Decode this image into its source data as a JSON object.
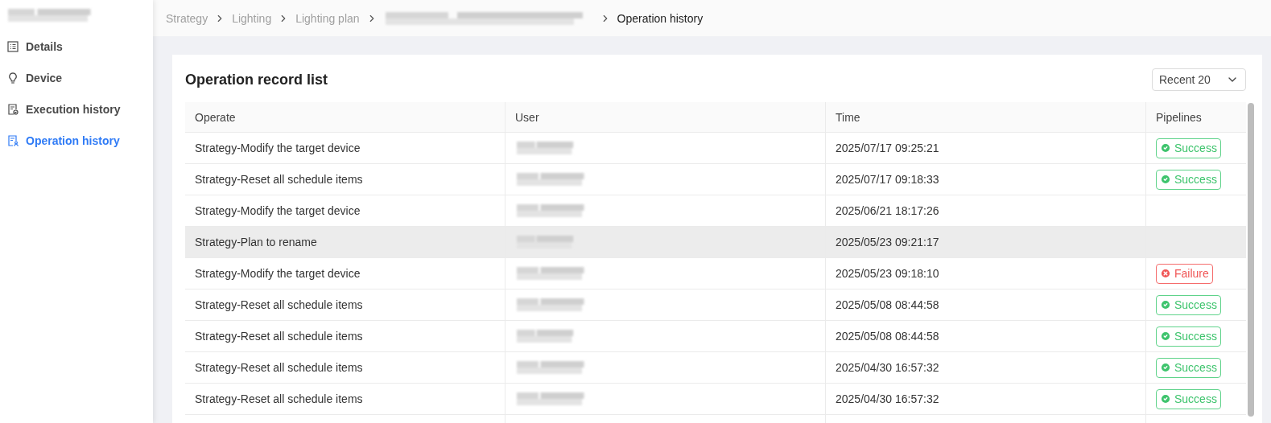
{
  "sidebar": {
    "items": [
      {
        "label": "Details",
        "selected": false
      },
      {
        "label": "Device",
        "selected": false
      },
      {
        "label": "Execution history",
        "selected": false
      },
      {
        "label": "Operation history",
        "selected": true
      }
    ]
  },
  "breadcrumb": [
    "Strategy",
    "Lighting",
    "Lighting plan",
    "Operation history"
  ],
  "card": {
    "title": "Operation record list",
    "filter": {
      "value": "Recent 20"
    }
  },
  "table": {
    "columns": [
      "Operate",
      "User",
      "Time",
      "Pipelines"
    ],
    "rows": [
      {
        "operate": "Strategy-Modify the target device",
        "time": "2025/07/17 09:25:21",
        "status": {
          "kind": "success",
          "label": "Success"
        },
        "selected": false
      },
      {
        "operate": "Strategy-Reset all schedule items",
        "time": "2025/07/17 09:18:33",
        "status": {
          "kind": "success",
          "label": "Success"
        },
        "selected": false
      },
      {
        "operate": "Strategy-Modify the target device",
        "time": "2025/06/21 18:17:26",
        "selected": false
      },
      {
        "operate": "Strategy-Plan to rename",
        "time": "2025/05/23 09:21:17",
        "selected": true
      },
      {
        "operate": "Strategy-Modify the target device",
        "time": "2025/05/23 09:18:10",
        "status": {
          "kind": "failure",
          "label": "Failure"
        },
        "selected": false
      },
      {
        "operate": "Strategy-Reset all schedule items",
        "time": "2025/05/08 08:44:58",
        "status": {
          "kind": "success",
          "label": "Success"
        },
        "selected": false
      },
      {
        "operate": "Strategy-Reset all schedule items",
        "time": "2025/05/08 08:44:58",
        "status": {
          "kind": "success",
          "label": "Success"
        },
        "selected": false
      },
      {
        "operate": "Strategy-Reset all schedule items",
        "time": "2025/04/30 16:57:32",
        "status": {
          "kind": "success",
          "label": "Success"
        },
        "selected": false
      },
      {
        "operate": "Strategy-Reset all schedule items",
        "time": "2025/04/30 16:57:32",
        "status": {
          "kind": "success",
          "label": "Success"
        },
        "selected": false
      }
    ]
  }
}
